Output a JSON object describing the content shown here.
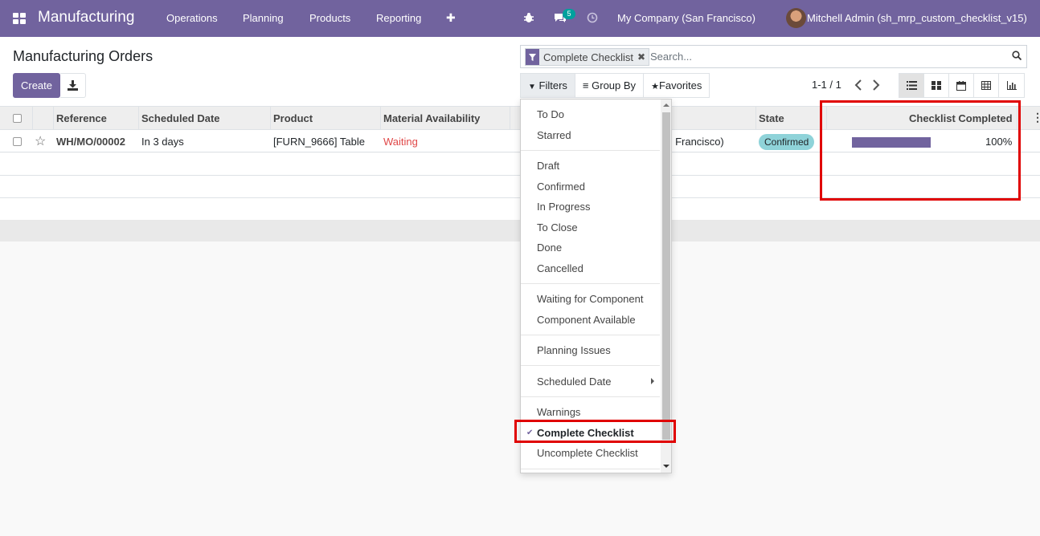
{
  "topbar": {
    "app": "Manufacturing",
    "menus": [
      "Operations",
      "Planning",
      "Products",
      "Reporting"
    ],
    "plus": "✚",
    "chat_count": "5",
    "company": "My Company (San Francisco)",
    "user": "Mitchell Admin (sh_mrp_custom_checklist_v15)",
    "accent": "#71639e"
  },
  "control": {
    "title": "Manufacturing Orders",
    "create": "Create",
    "facet": "Complete Checklist",
    "search_placeholder": "Search...",
    "filters": "Filters",
    "group_by": "Group By",
    "favorites": "Favorites",
    "pager": "1-1 / 1"
  },
  "table": {
    "headers": [
      "Reference",
      "Scheduled Date",
      "Product",
      "Material Availability",
      "State",
      "Checklist Completed"
    ],
    "row": {
      "reference": "WH/MO/00002",
      "date": "In 3 days",
      "product": "[FURN_9666] Table",
      "availability": "Waiting",
      "company": "an Francisco)",
      "state": "Confirmed",
      "progress_label": "100%",
      "progress": 1.0
    }
  },
  "filters": {
    "g1": [
      "To Do",
      "Starred"
    ],
    "g2": [
      "Draft",
      "Confirmed",
      "In Progress",
      "To Close",
      "Done",
      "Cancelled"
    ],
    "g3": [
      "Waiting for Component",
      "Component Available"
    ],
    "g4": [
      "Planning Issues"
    ],
    "g5": [
      "Scheduled Date"
    ],
    "g6": [
      "Warnings",
      "Complete Checklist",
      "Uncomplete Checklist"
    ]
  },
  "colors": {
    "waiting": "#e04848",
    "confirmed_pill": "#8fd3d9",
    "highlight": "#e00000"
  }
}
